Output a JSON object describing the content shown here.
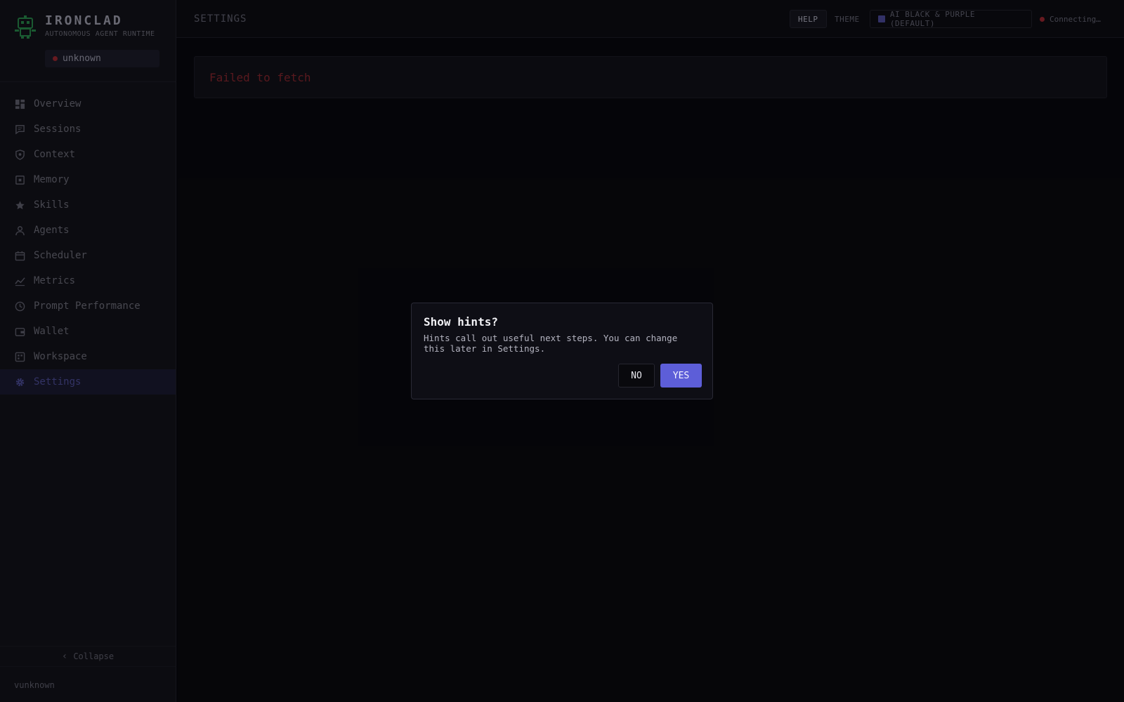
{
  "brand": {
    "name": "IRONCLAD",
    "subtitle": "AUTONOMOUS AGENT RUNTIME",
    "status": "unknown"
  },
  "sidebar": {
    "items": [
      {
        "label": "Overview",
        "icon": "grid-icon"
      },
      {
        "label": "Sessions",
        "icon": "chat-icon"
      },
      {
        "label": "Context",
        "icon": "shield-icon"
      },
      {
        "label": "Memory",
        "icon": "chip-icon"
      },
      {
        "label": "Skills",
        "icon": "star-icon"
      },
      {
        "label": "Agents",
        "icon": "user-icon"
      },
      {
        "label": "Scheduler",
        "icon": "calendar-icon"
      },
      {
        "label": "Metrics",
        "icon": "chart-line-icon"
      },
      {
        "label": "Prompt Performance",
        "icon": "clock-icon"
      },
      {
        "label": "Wallet",
        "icon": "wallet-icon"
      },
      {
        "label": "Workspace",
        "icon": "workspace-icon"
      },
      {
        "label": "Settings",
        "icon": "gear-icon",
        "active": true
      }
    ],
    "collapse_label": "Collapse",
    "footer_user": "vunknown"
  },
  "topbar": {
    "title": "SETTINGS",
    "help_label": "HELP",
    "theme_label": "THEME",
    "theme_value": "AI BLACK & PURPLE (DEFAULT)",
    "connection_status": "Connecting…"
  },
  "main": {
    "error": "Failed to fetch"
  },
  "modal": {
    "title": "Show hints?",
    "body": "Hints call out useful next steps. You can change this later in Settings.",
    "no_label": "NO",
    "yes_label": "YES"
  },
  "colors": {
    "accent": "#5d5ed8",
    "error": "#6a1e24",
    "status_dot": "#7a1f26"
  }
}
